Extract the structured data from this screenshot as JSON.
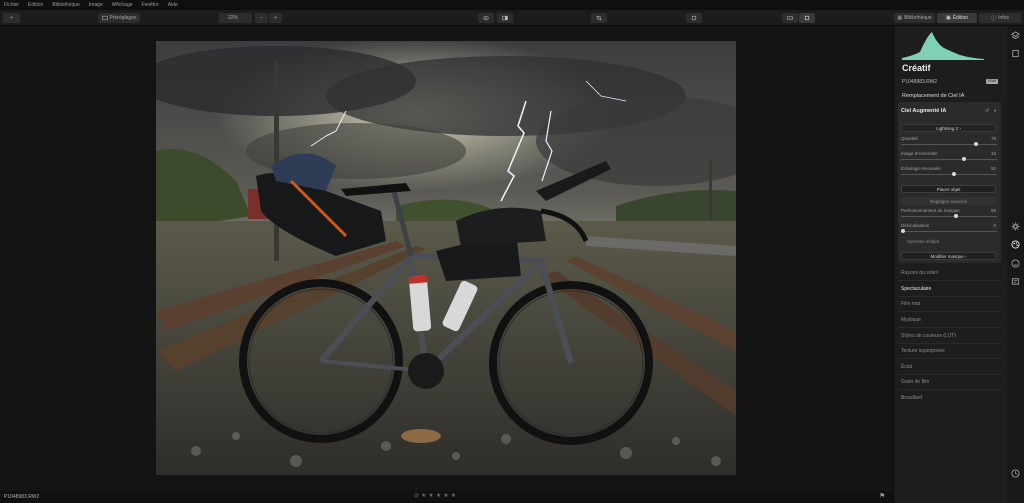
{
  "menu": [
    "Fichier",
    "Edition",
    "Bibliothèque",
    "Image",
    "Affichage",
    "Fenêtre",
    "Aide"
  ],
  "toolbar": {
    "add_icon": "plus-icon",
    "presets_label": "Préréglages",
    "zoom_label": "22%",
    "zoom_minus": "−",
    "zoom_plus": "+",
    "tab_library": "Bibliothèque",
    "tab_edit": "Édition",
    "tab_info": "Infos"
  },
  "status": {
    "filename": "P1048983.RW2",
    "stars": [
      "★",
      "★",
      "★",
      "★",
      "★"
    ],
    "reject": "⊘",
    "flag": "⚑"
  },
  "panel": {
    "title": "Créatif",
    "file": "P1048983.RW2",
    "raw": "RAW",
    "section": "Remplacement de Ciel IA",
    "tool": {
      "title": "Ciel Augmenté IA",
      "dropdown": "Lightning 2 ›",
      "sliders": [
        {
          "label": "Quantité",
          "value": "78",
          "fraction": 0.78
        },
        {
          "label": "Image d'ensemble",
          "value": "33",
          "fraction": 0.66
        },
        {
          "label": "Éclairage renouvelé",
          "value": "50",
          "fraction": 0.55
        }
      ],
      "place_button": "Placer objet",
      "advanced_button": "Réglages avancés",
      "slider2": [
        {
          "label": "Perfectionnement du masque",
          "value": "55",
          "fraction": 0.55
        },
        {
          "label": "Défocalisation",
          "value": "0",
          "fraction": 0.0
        }
      ],
      "note": "Symétrie d'objet",
      "edit_mask": "Modifier masque ›"
    },
    "items": [
      "Rayons du soleil",
      "Spectaculaire",
      "Film mat",
      "Mystique",
      "Styles de couleurs (LUT)",
      "Texture superposée",
      "Éclat",
      "Grain de film",
      "Brouillard"
    ]
  },
  "colors": {
    "accent": "#7fd0b6",
    "panel": "#1d1d1d"
  }
}
